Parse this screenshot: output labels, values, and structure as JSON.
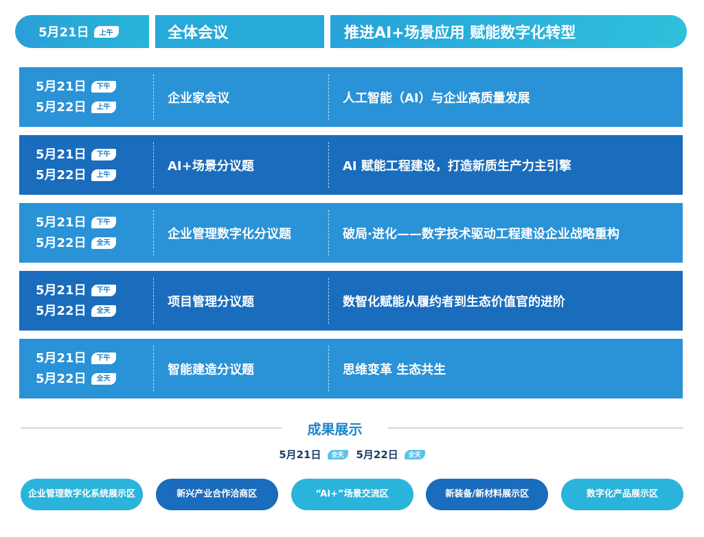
{
  "plenary": {
    "date": "5月21日",
    "period": "上午",
    "title": "全体会议",
    "theme": "推进AI+场景应用  赋能数字化转型"
  },
  "sessions": [
    {
      "date1": "5月21日",
      "period1": "下午",
      "date2": "5月22日",
      "period2": "上午",
      "name": "企业家会议",
      "theme": "人工智能（AI）与企业高质量发展"
    },
    {
      "date1": "5月21日",
      "period1": "下午",
      "date2": "5月22日",
      "period2": "上午",
      "name": "AI+场景分议题",
      "theme": "AI 赋能工程建设，打造新质生产力主引擎"
    },
    {
      "date1": "5月21日",
      "period1": "下午",
      "date2": "5月22日",
      "period2": "全天",
      "name": "企业管理数字化分议题",
      "theme": "破局·进化——数字技术驱动工程建设企业战略重构"
    },
    {
      "date1": "5月21日",
      "period1": "下午",
      "date2": "5月22日",
      "period2": "全天",
      "name": "项目管理分议题",
      "theme": "数智化赋能从履约者到生态价值官的进阶"
    },
    {
      "date1": "5月21日",
      "period1": "下午",
      "date2": "5月22日",
      "period2": "全天",
      "name": "智能建造分议题",
      "theme": "思维变革 生态共生"
    }
  ],
  "exhibition": {
    "title": "成果展示",
    "date1": "5月21日",
    "period1": "全天",
    "date2": "5月22日",
    "period2": "全天",
    "halls": [
      "企业管理数字化系统展示区",
      "新兴产业合作洽商区",
      "“AI+”场景交流区",
      "新装备/新材料展示区",
      "数字化产品展示区"
    ]
  },
  "colors": {
    "light_row": "#2a92d6",
    "dark_row": "#1a6cbd",
    "cyan": "#2ab4db",
    "title_blue": "#1f84c9"
  }
}
